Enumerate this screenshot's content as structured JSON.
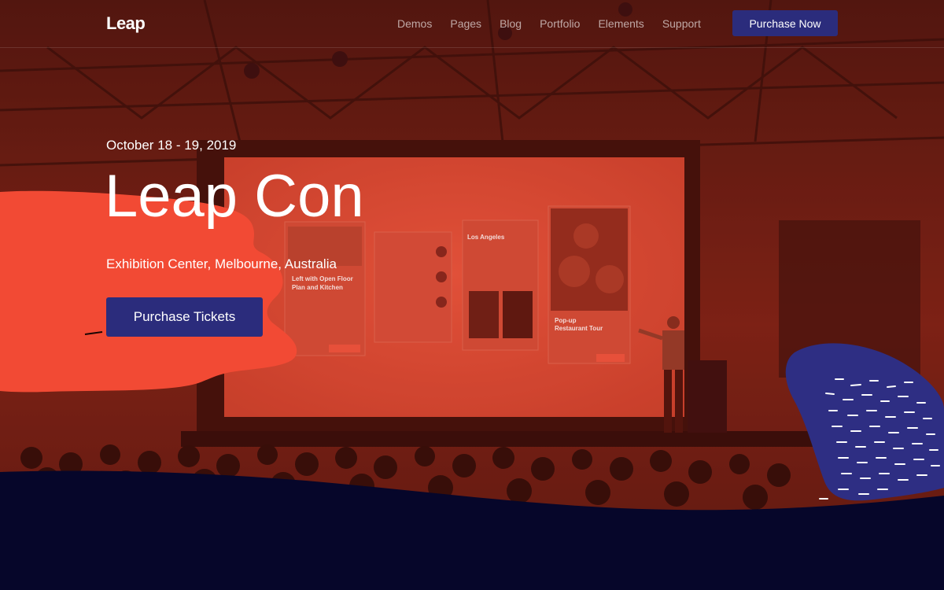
{
  "header": {
    "logo": "Leap",
    "nav": [
      "Demos",
      "Pages",
      "Blog",
      "Portfolio",
      "Elements",
      "Support"
    ],
    "cta": "Purchase Now"
  },
  "hero": {
    "date": "October 18 - 19, 2019",
    "title": "Leap Con",
    "venue": "Exhibition Center, Melbourne, Australia",
    "cta": "Purchase Tickets"
  },
  "screen_cards": {
    "card1_title": "Left with Open Floor Plan and Kitchen",
    "card3_title": "Los Angeles",
    "card4_title": "Pop-up Restaurant Tour"
  },
  "colors": {
    "overlay": "#c23a25",
    "accent_red": "#f24a34",
    "accent_indigo": "#2b2c7c",
    "blob_indigo": "#2e2e83",
    "footer_navy": "#06062a"
  }
}
